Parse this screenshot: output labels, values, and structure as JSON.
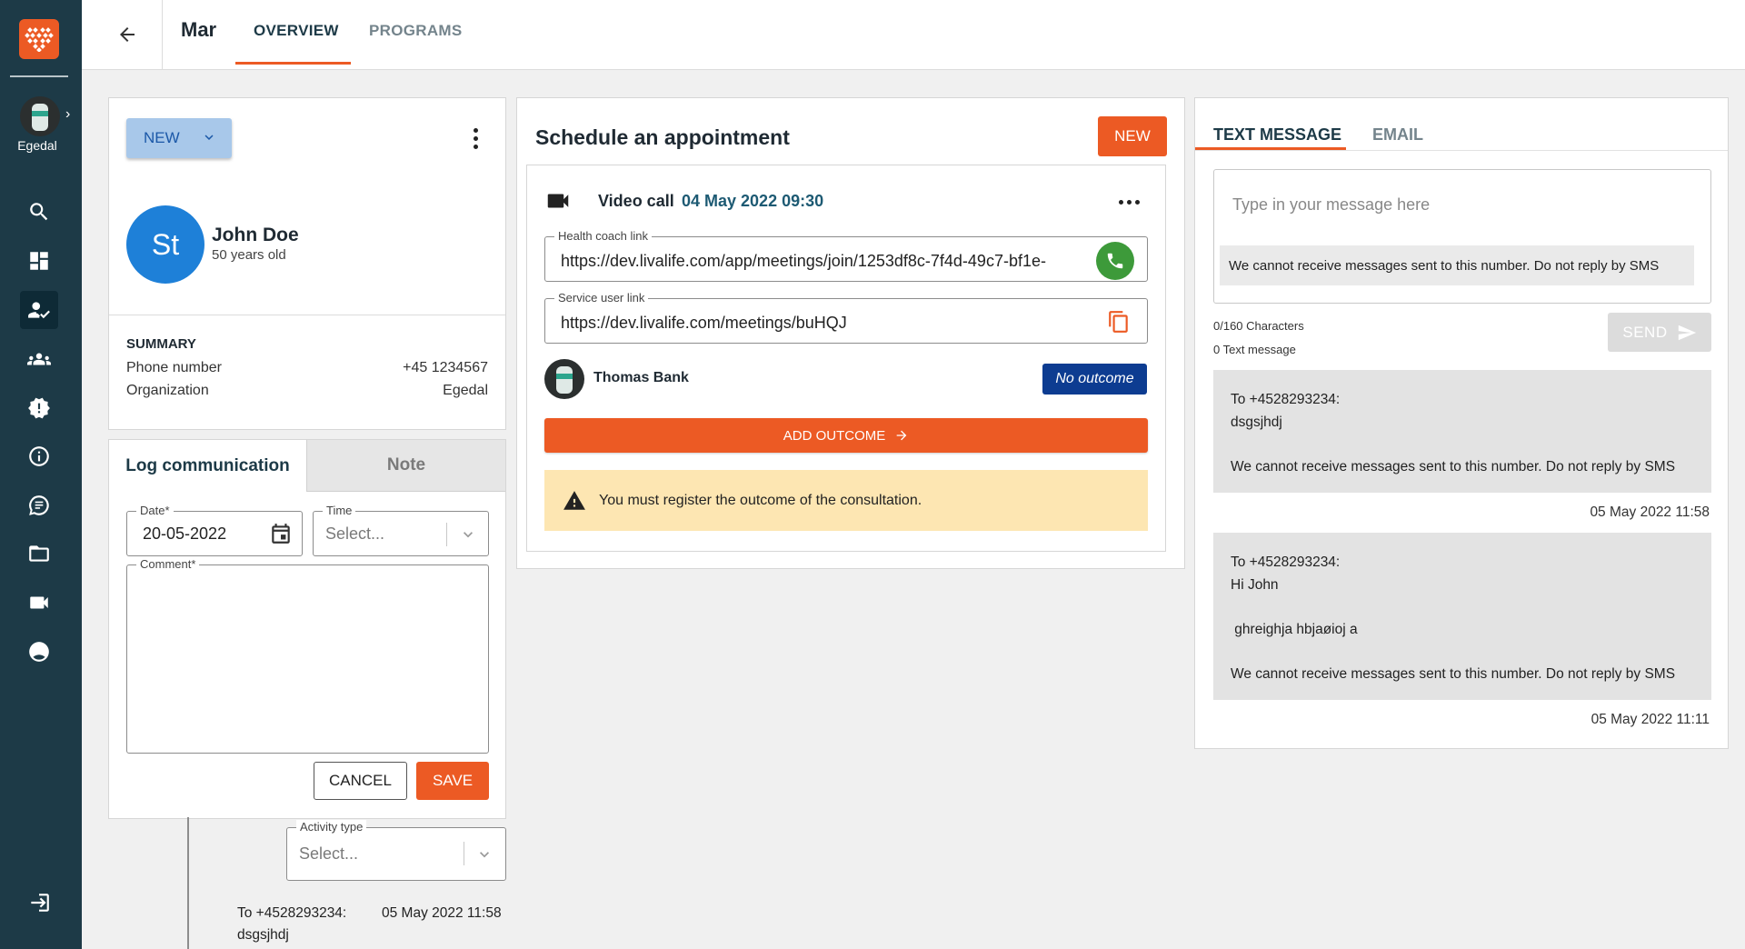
{
  "sidebar": {
    "user_name": "Egedal",
    "nav": [
      {
        "icon": "search-icon"
      },
      {
        "icon": "dashboard-icon"
      },
      {
        "icon": "patient-check-icon"
      },
      {
        "icon": "group-icon"
      },
      {
        "icon": "alert-badge-icon"
      },
      {
        "icon": "info-icon"
      },
      {
        "icon": "chat-icon"
      },
      {
        "icon": "folder-icon"
      },
      {
        "icon": "video-icon"
      },
      {
        "icon": "account-circle-icon"
      }
    ],
    "logout_icon": "logout-icon"
  },
  "topbar": {
    "title": "Mar",
    "tabs": [
      {
        "label": "OVERVIEW",
        "active": true
      },
      {
        "label": "PROGRAMS",
        "active": false
      }
    ]
  },
  "patient": {
    "new_button": "NEW",
    "initials": "St",
    "name": "John Doe",
    "age": "50 years old",
    "summary_title": "SUMMARY",
    "phone_label": "Phone number",
    "phone_value": "+45 1234567",
    "org_label": "Organization",
    "org_value": "Egedal"
  },
  "log": {
    "tab_active": "Log communication",
    "tab_inactive": "Note",
    "date_label": "Date",
    "date_value": "20-05-2022",
    "time_label": "Time",
    "time_placeholder": "Select...",
    "comment_label": "Comment",
    "cancel": "CANCEL",
    "save": "SAVE",
    "activity_label": "Activity type",
    "activity_placeholder": "Select...",
    "history_to": "To +4528293234:",
    "history_time": "05 May 2022 11:58",
    "history_text": "dsgsjhdj"
  },
  "appointment": {
    "title": "Schedule an appointment",
    "new_button": "NEW",
    "type": "Video call",
    "datetime": "04 May 2022 09:30",
    "coach_link_label": "Health coach link",
    "coach_link": "https://dev.livalife.com/app/meetings/join/1253df8c-7f4d-49c7-bf1e-",
    "user_link_label": "Service user link",
    "user_link": "https://dev.livalife.com/meetings/buHQJ",
    "coach_name": "Thomas Bank",
    "outcome_badge": "No outcome",
    "add_outcome": "ADD OUTCOME",
    "warning": "You must register the outcome of the consultation."
  },
  "messaging": {
    "tab_active": "TEXT MESSAGE",
    "tab_inactive": "EMAIL",
    "placeholder": "Type in your message here",
    "disclaimer": "We cannot receive messages sent to this number. Do not reply by SMS",
    "char_count": "0/160 Characters",
    "msg_count": "0 Text message",
    "send": "SEND",
    "messages": [
      {
        "to": "To +4528293234:",
        "lines": [
          "dsgsjhdj",
          "",
          "We cannot receive messages sent to this number. Do not reply by SMS"
        ],
        "time": "05 May 2022 11:58"
      },
      {
        "to": "To +4528293234:",
        "lines": [
          "Hi John",
          "",
          " ghreighja hbjaøioj a",
          "",
          "We cannot receive messages sent to this number. Do not reply by SMS"
        ],
        "time": "05 May 2022 11:11"
      }
    ]
  },
  "colors": {
    "sidebar": "#1d3a47",
    "accent": "#ec5a24",
    "avatar": "#1e80d8",
    "badge": "#0d3c91",
    "warning": "#fde6b2"
  }
}
